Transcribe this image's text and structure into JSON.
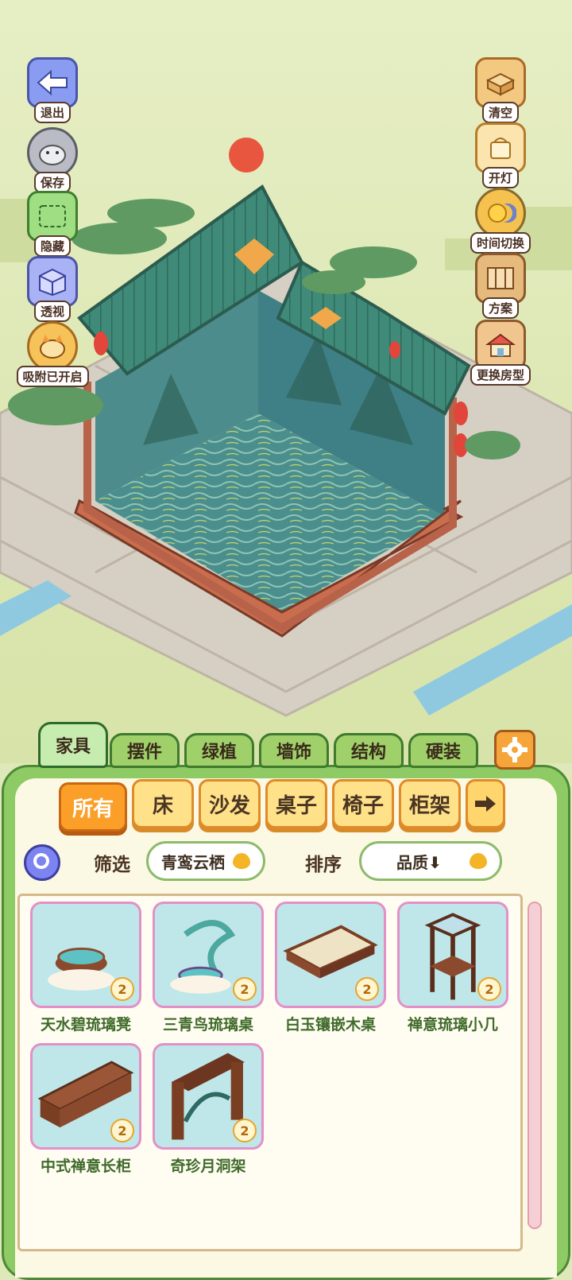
{
  "left_buttons": [
    {
      "label": "退出",
      "icon": "exit-arrow-icon"
    },
    {
      "label": "保存",
      "icon": "hamster-save-icon"
    },
    {
      "label": "隐藏",
      "icon": "hide-icon"
    },
    {
      "label": "透视",
      "icon": "perspective-cube-icon"
    },
    {
      "label": "吸附已开启",
      "icon": "snap-fox-icon"
    }
  ],
  "right_buttons": [
    {
      "label": "清空",
      "icon": "clear-box-icon"
    },
    {
      "label": "开灯",
      "icon": "light-icon"
    },
    {
      "label": "时间切换",
      "icon": "time-switch-icon"
    },
    {
      "label": "方案",
      "icon": "plan-icon"
    },
    {
      "label": "更换房型",
      "icon": "house-icon"
    }
  ],
  "tabs": [
    "家具",
    "摆件",
    "绿植",
    "墙饰",
    "结构",
    "硬装"
  ],
  "active_tab": "家具",
  "categories": [
    "所有",
    "床",
    "沙发",
    "桌子",
    "椅子",
    "柜架"
  ],
  "active_category": "所有",
  "filter": {
    "label": "筛选",
    "value": "青鸾云栖"
  },
  "sort": {
    "label": "排序",
    "value": "品质⬇"
  },
  "items": [
    {
      "name": "天水碧琉璃凳",
      "qty": "2"
    },
    {
      "name": "三青鸟琉璃桌",
      "qty": "2"
    },
    {
      "name": "白玉镶嵌木桌",
      "qty": "2"
    },
    {
      "name": "禅意琉璃小几",
      "qty": "2"
    },
    {
      "name": "中式禅意长柜",
      "qty": "2"
    },
    {
      "name": "奇珍月洞架",
      "qty": "2"
    }
  ],
  "colors": {
    "sky": "#dfe8b8",
    "tile": "#d9d2c6",
    "roof": "#3f8a78",
    "wall": "#3f7f86",
    "accent": "#fb9f28",
    "panel": "#8ecb64"
  }
}
